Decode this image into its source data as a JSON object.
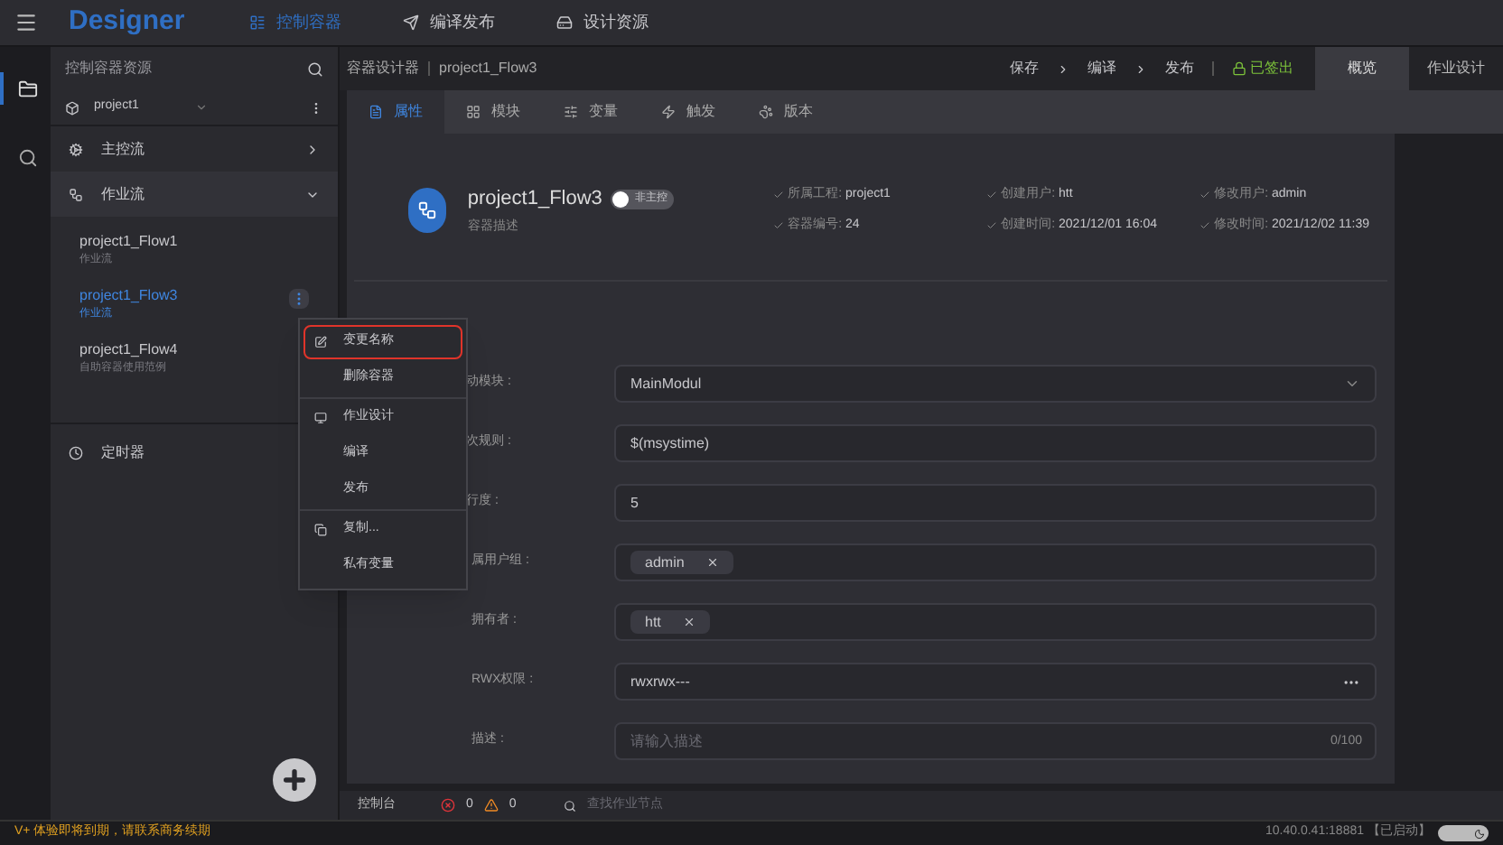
{
  "topbar": {
    "logo": "Designer",
    "nav": [
      {
        "label": "控制容器",
        "selected": true
      },
      {
        "label": "编译发布",
        "selected": false
      },
      {
        "label": "设计资源",
        "selected": false
      }
    ]
  },
  "rail": [
    {
      "kind": "folder",
      "selected": true
    },
    {
      "kind": "search",
      "selected": false
    }
  ],
  "sidebar": {
    "title": "控制容器资源",
    "project": "project1",
    "groups": [
      {
        "label": "主控流",
        "expanded": false
      },
      {
        "label": "作业流",
        "expanded": true
      }
    ],
    "flows": [
      {
        "name": "project1_Flow1",
        "type": "作业流",
        "selected": false
      },
      {
        "name": "project1_Flow3",
        "type": "作业流",
        "selected": true
      },
      {
        "name": "project1_Flow4",
        "type": "自助容器使用范例",
        "selected": false
      }
    ],
    "timer": "定时器"
  },
  "context_menu": {
    "groups": [
      [
        {
          "label": "变更名称",
          "kind": "edit",
          "selected": true
        },
        {
          "label": "删除容器",
          "kind": "plain",
          "selected": false
        }
      ],
      [
        {
          "label": "作业设计",
          "kind": "design",
          "selected": false
        },
        {
          "label": "编译",
          "kind": "plain",
          "selected": false
        },
        {
          "label": "发布",
          "kind": "plain",
          "selected": false
        }
      ],
      [
        {
          "label": "复制...",
          "kind": "copy",
          "selected": false
        },
        {
          "label": "私有变量",
          "kind": "plain",
          "selected": false
        }
      ]
    ]
  },
  "header": {
    "breadcrumb": [
      "容器设计器",
      "project1_Flow3"
    ],
    "actions": [
      "保存",
      "编译",
      "发布"
    ],
    "lock": "已签出",
    "views": [
      {
        "label": "概览",
        "selected": true
      },
      {
        "label": "作业设计",
        "selected": false
      }
    ]
  },
  "tabs": [
    {
      "label": "属性",
      "kind": "props",
      "selected": true
    },
    {
      "label": "模块",
      "kind": "modules",
      "selected": false
    },
    {
      "label": "变量",
      "kind": "vars",
      "selected": false
    },
    {
      "label": "触发",
      "kind": "trigger",
      "selected": false
    },
    {
      "label": "版本",
      "kind": "version",
      "selected": false
    }
  ],
  "summary": {
    "name": "project1_Flow3",
    "toggle": {
      "label": "非主控",
      "on": false
    },
    "description": "容器描述",
    "meta": [
      {
        "label": "所属工程:",
        "value": "project1"
      },
      {
        "label": "创建用户:",
        "value": "htt"
      },
      {
        "label": "修改用户:",
        "value": "admin"
      },
      {
        "label": "容器编号:",
        "value": "24"
      },
      {
        "label": "创建时间:",
        "value": "2021/12/01 16:04"
      },
      {
        "label": "修改时间:",
        "value": "2021/12/02 11:39"
      }
    ]
  },
  "form": [
    {
      "label": "动模块 :",
      "kind": "select",
      "value": "MainModul"
    },
    {
      "label": "次规则 :",
      "kind": "text",
      "value": "$(msystime)"
    },
    {
      "label": "行度 :",
      "kind": "text",
      "value": "5"
    },
    {
      "label": "属用户组 :",
      "kind": "tags",
      "tags": [
        "admin"
      ]
    },
    {
      "label": "拥有者 :",
      "kind": "tags",
      "tags": [
        "htt"
      ]
    },
    {
      "label": "RWX权限 :",
      "kind": "more",
      "value": "rwxrwx---"
    },
    {
      "label": "描述 :",
      "kind": "textarea",
      "placeholder": "请输入描述",
      "counter": "0/100"
    }
  ],
  "console": {
    "title": "控制台",
    "errors": "0",
    "warnings": "0",
    "search_placeholder": "查找作业节点"
  },
  "status": {
    "notice": "V+ 体验即将到期，请联系商务续期",
    "server": "10.40.0.41:18881",
    "state": "【已启动】"
  }
}
